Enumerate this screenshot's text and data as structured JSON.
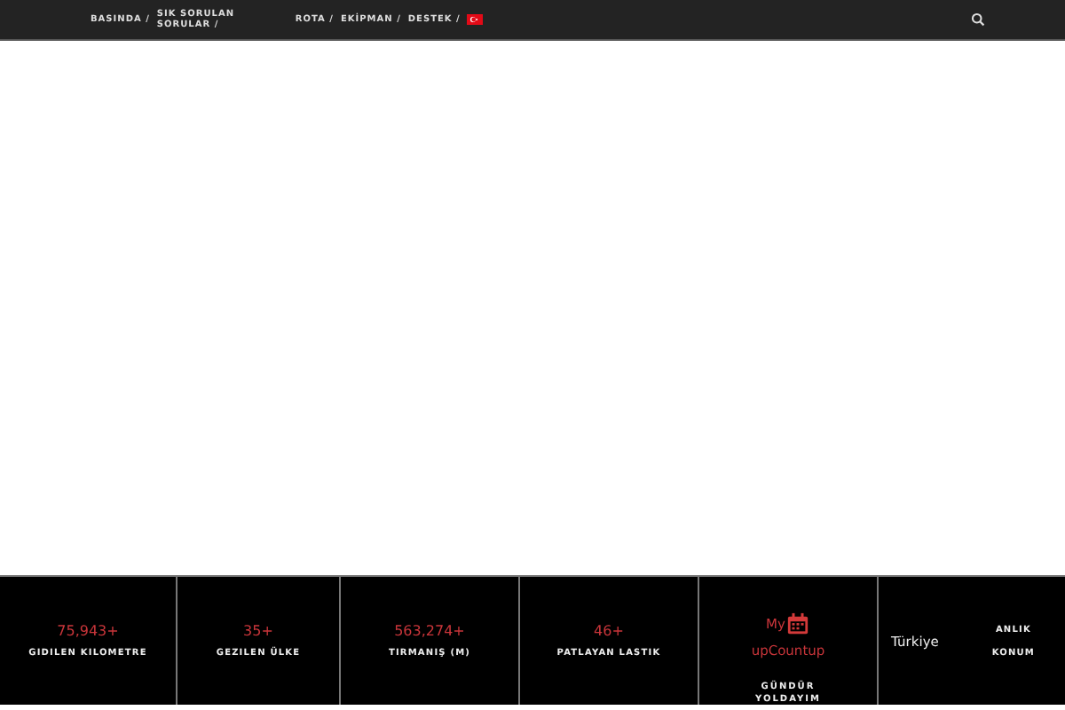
{
  "nav": {
    "left": [
      "BASINDA /",
      "SIK SORULAN SORULAR /"
    ],
    "right": [
      "ROTA /",
      "EKİPMAN /",
      "DESTEK /"
    ]
  },
  "stats": [
    {
      "kind": "stat",
      "value": "75,943+",
      "label": "GIDILEN KILOMETRE"
    },
    {
      "kind": "stat",
      "value": "35+",
      "label": "GEZILEN ÜLKE"
    },
    {
      "kind": "stat",
      "value": "563,274+",
      "label": "TIRMANIŞ (M)"
    },
    {
      "kind": "stat",
      "value": "46+",
      "label": "PATLAYAN LASTIK"
    },
    {
      "kind": "counter",
      "top": "My",
      "value": "upCountup",
      "label": [
        "GÜNDÜR",
        "YOLDAYIM"
      ]
    },
    {
      "kind": "location",
      "place": "Türkiye",
      "label": [
        "ANLIK",
        "KONUM"
      ]
    }
  ]
}
